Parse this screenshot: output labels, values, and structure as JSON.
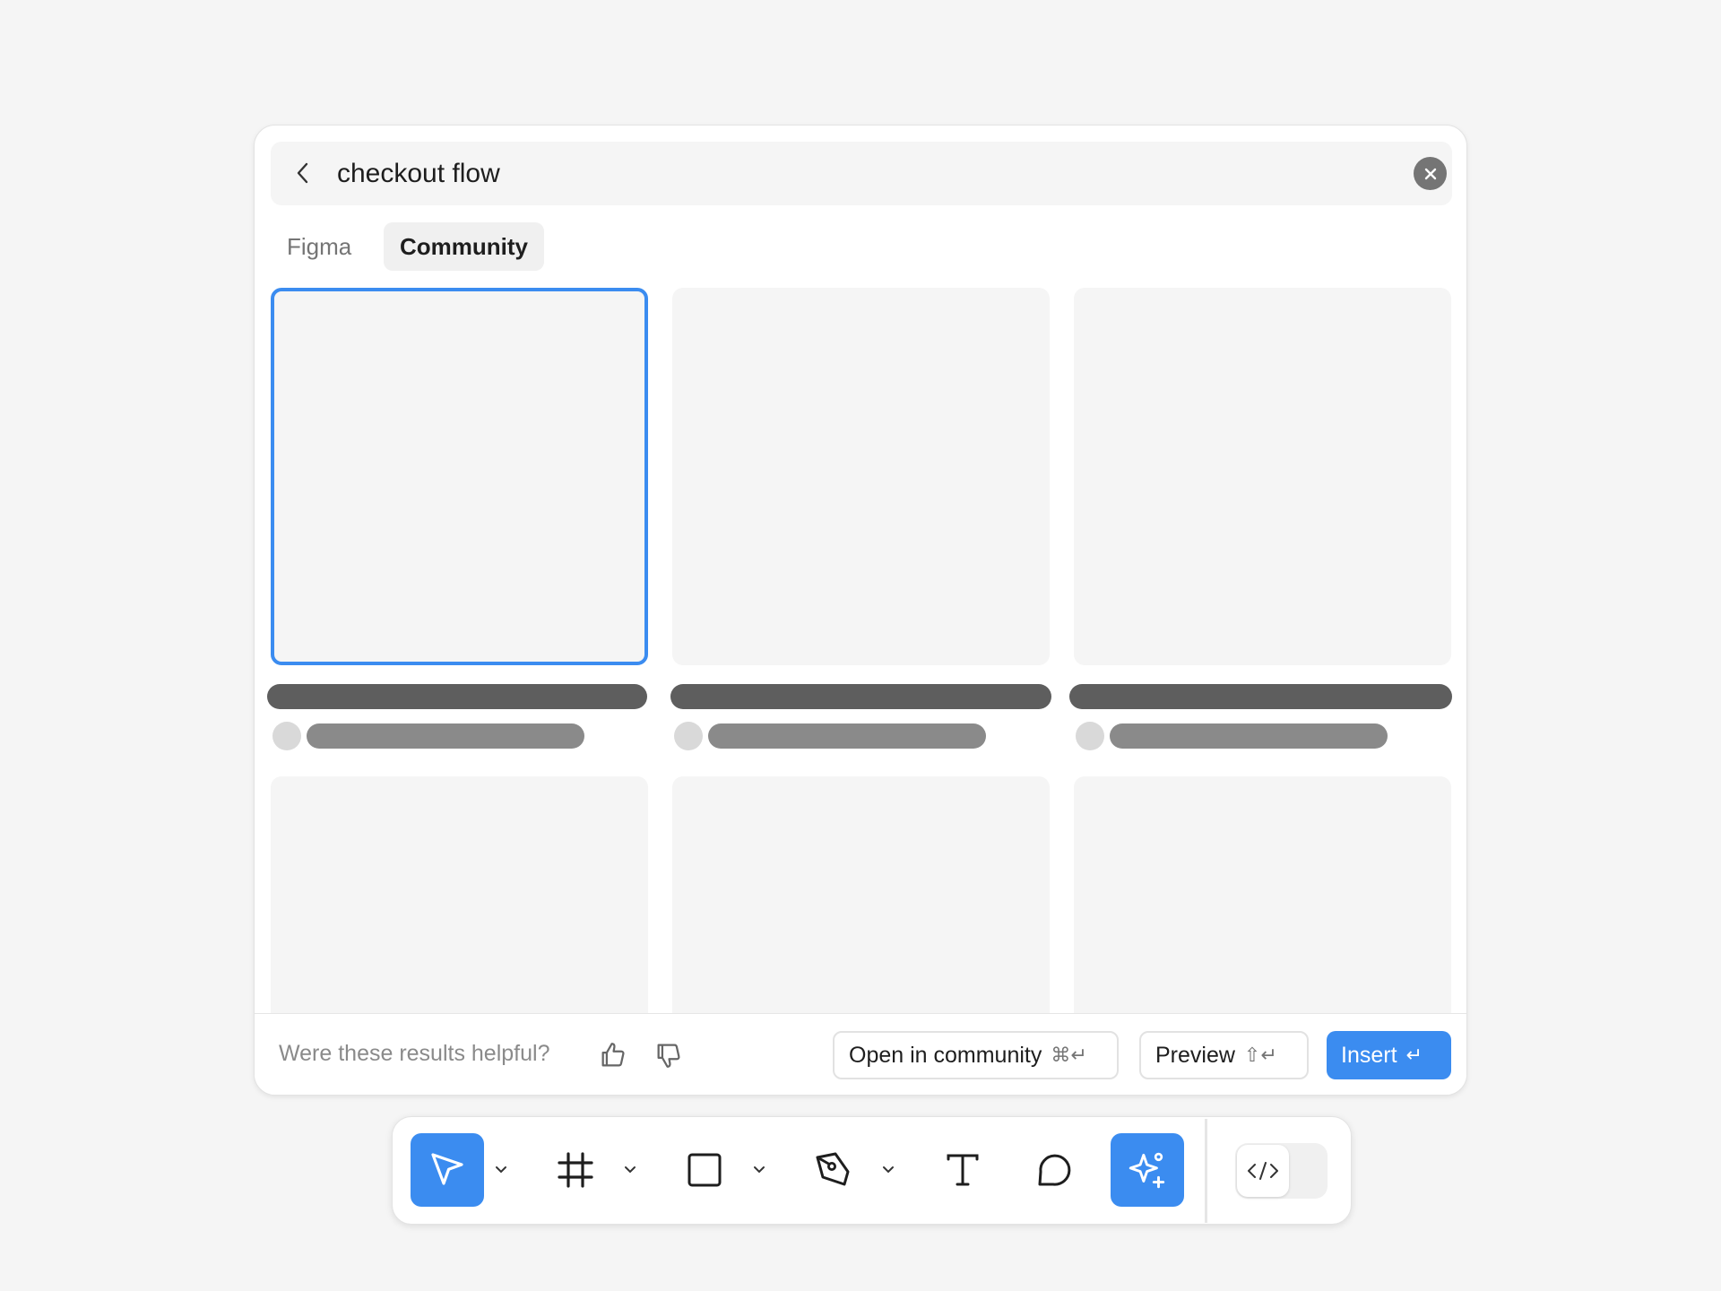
{
  "search": {
    "query": "checkout flow",
    "placeholder": ""
  },
  "tabs": [
    {
      "label": "Figma",
      "active": false
    },
    {
      "label": "Community",
      "active": true
    }
  ],
  "results": {
    "selected_index": 0,
    "loading": true
  },
  "footer": {
    "feedback_prompt": "Were these results helpful?",
    "open_label": "Open in community",
    "open_shortcut": "⌘↵",
    "preview_label": "Preview",
    "preview_shortcut": "⇧↵",
    "insert_label": "Insert",
    "insert_shortcut": "↵"
  },
  "toolbar": {
    "tools": [
      "move-icon",
      "frame-icon",
      "rectangle-icon",
      "pen-icon",
      "text-icon",
      "comment-icon",
      "ai-sparkle-icon"
    ],
    "active_tools": [
      "move-icon",
      "ai-sparkle-icon"
    ],
    "dev_mode_icon": "code-icon"
  },
  "colors": {
    "accent": "#3b8cf0",
    "skeleton_dark": "#5e5e5e",
    "skeleton_mid": "#8a8a8a",
    "card_bg": "#f5f5f5"
  }
}
